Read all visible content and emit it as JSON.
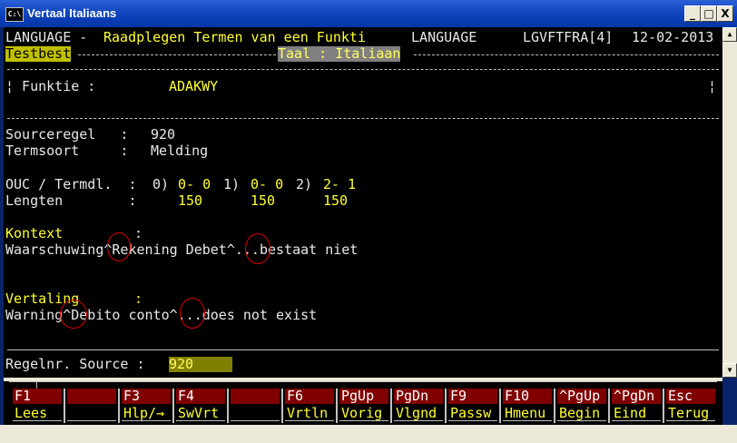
{
  "window": {
    "title": "Vertaal Italiaans",
    "icon_text": "C:\\",
    "min_glyph": "_",
    "max_glyph": "□",
    "close_glyph": "X"
  },
  "header": {
    "left": "LANGUAGE - ",
    "title": "Raadplegen Termen van een Funkti",
    "mid": " LANGUAGE",
    "code": "LGVFTFRA[4]",
    "date": "12-02-2013"
  },
  "subheader": {
    "left": "Testbest",
    "right": "Taal : Italiaan"
  },
  "funktie": {
    "label": "¦ Funktie :",
    "value": "ADAKWY",
    "right": "¦"
  },
  "fields": {
    "sourceregel_label": "Sourceregel   :",
    "sourceregel_value": "920",
    "termsoort_label": "Termsoort     :",
    "termsoort_value": "Melding",
    "ouc_label": "OUC / Termdl.  :",
    "ouc_0": "0)",
    "ouc_0_val": "0- 0",
    "ouc_1": "1)",
    "ouc_1_val": "0- 0",
    "ouc_2": "2)",
    "ouc_2_val": "2- 1",
    "lengten_label": "Lengten        :",
    "len_0": "150",
    "len_1": "150",
    "len_2": "150"
  },
  "kontext": {
    "label": "Kontext",
    "colon": ":",
    "text": "Waarschuwing^Rekening Debet^...bestaat niet"
  },
  "vertaling": {
    "label": "Vertaling",
    "colon": ":",
    "text": "Warning^Debito conto^...does not exist"
  },
  "input": {
    "label": "Regelnr. Source :",
    "value": "920"
  },
  "fkeys": [
    {
      "key": "F1",
      "label": "Lees"
    },
    {
      "key": "",
      "label": ""
    },
    {
      "key": "F3",
      "label": "Hlp/→"
    },
    {
      "key": "F4",
      "label": "SwVrt"
    },
    {
      "key": "",
      "label": ""
    },
    {
      "key": "F6",
      "label": "Vrtln"
    },
    {
      "key": "PgUp",
      "label": "Vorig"
    },
    {
      "key": "PgDn",
      "label": "Vlgnd"
    },
    {
      "key": "F9",
      "label": "Passw"
    },
    {
      "key": "F10",
      "label": "Hmenu"
    },
    {
      "key": "^PgUp",
      "label": "Begin"
    },
    {
      "key": "^PgDn",
      "label": "Eind"
    },
    {
      "key": "Esc",
      "label": "Terug"
    }
  ],
  "colors": {
    "console_bg": "#000000",
    "yellow": "#ffff30",
    "fkey_bg": "#800000",
    "annotation": "#e00000"
  }
}
